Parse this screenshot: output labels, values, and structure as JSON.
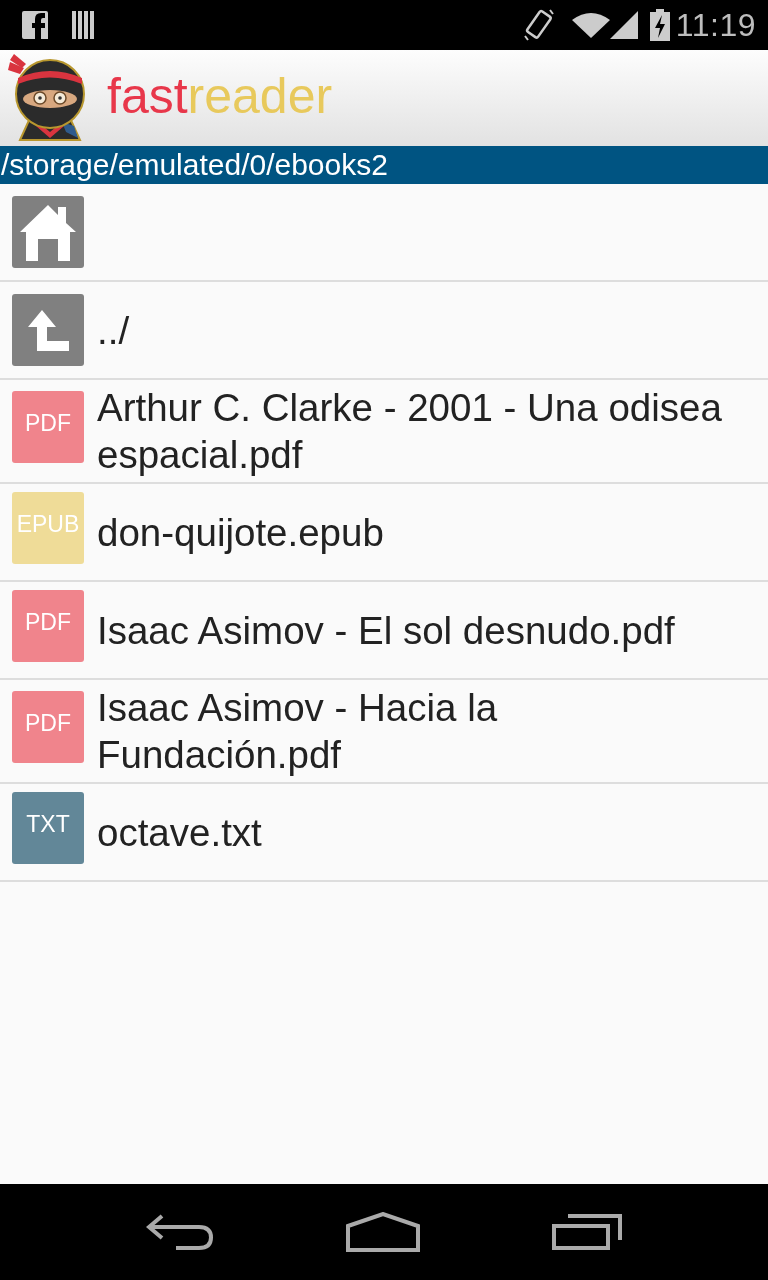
{
  "status_bar": {
    "time": "11:19"
  },
  "app_bar": {
    "title_parts": [
      {
        "text": "fast",
        "color": "#e8374a"
      },
      {
        "text": "reader",
        "color": "#e8c95c"
      }
    ]
  },
  "path_bar": {
    "path": "/storage/emulated/0/ebooks2"
  },
  "files": [
    {
      "kind": "home"
    },
    {
      "kind": "parent",
      "name": "../"
    },
    {
      "kind": "file",
      "badge": "PDF",
      "color": "#f0848c",
      "name": "Arthur C. Clarke - 2001 - Una odisea espacial.pdf"
    },
    {
      "kind": "file",
      "badge": "EPUB",
      "color": "#efdc98",
      "name": "don-quijote.epub"
    },
    {
      "kind": "file",
      "badge": "PDF",
      "color": "#f0848c",
      "name": "Isaac Asimov - El sol desnudo.pdf"
    },
    {
      "kind": "file",
      "badge": "PDF",
      "color": "#f0848c",
      "name": "Isaac Asimov - Hacia la Fundación.pdf"
    },
    {
      "kind": "file",
      "badge": "TXT",
      "color": "#628798",
      "name": "octave.txt"
    }
  ]
}
